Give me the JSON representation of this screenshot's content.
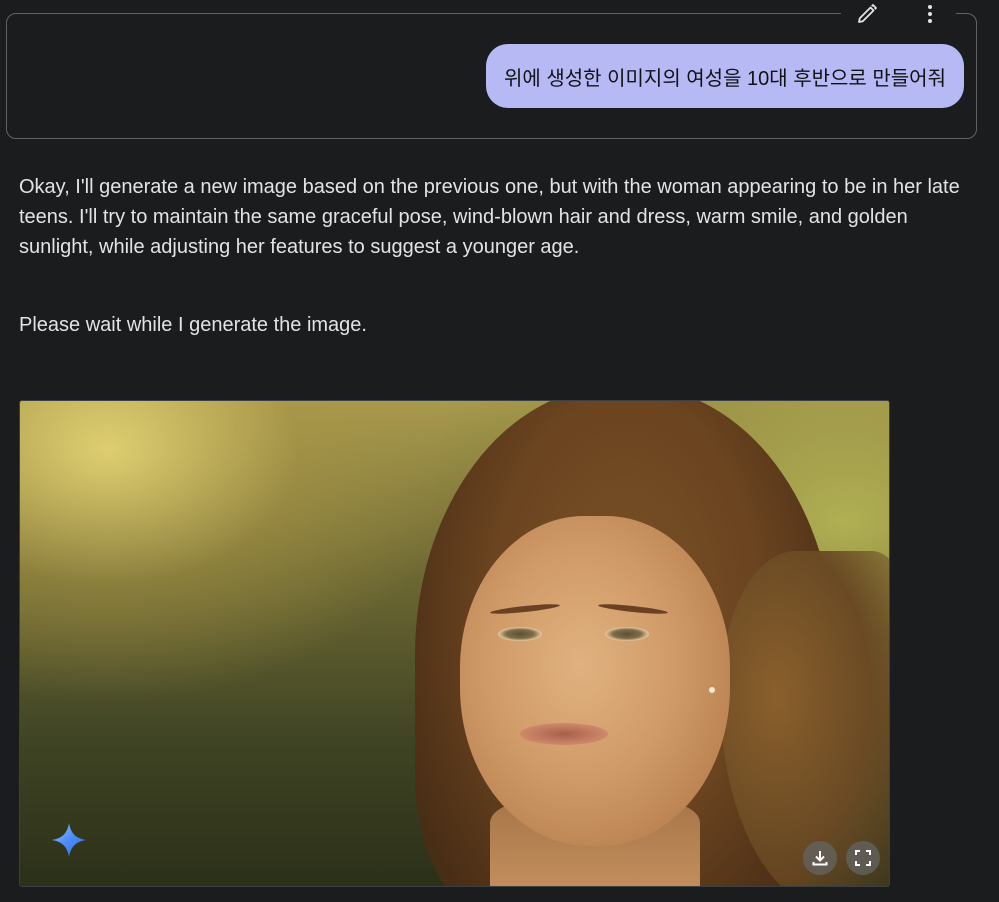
{
  "user_prompt": {
    "text": "위에 생성한 이미지의 여성을 10대 후반으로 만들어줘",
    "edit_icon": "pencil-icon",
    "more_icon": "more-vert-icon",
    "bubble_color": "#b7b9f5"
  },
  "response": {
    "paragraph_1": "Okay, I'll generate a new image based on the previous one, but with the woman appearing to be in her late teens. I'll try to maintain the same graceful pose, wind-blown hair and dress, warm smile, and golden sunlight, while adjusting her features to suggest a younger age.",
    "paragraph_2": "Please wait while I generate the image."
  },
  "generated_image": {
    "watermark_icon": "gemini-sparkle-icon",
    "download_icon": "download-icon",
    "fullscreen_icon": "fullscreen-icon"
  },
  "colors": {
    "background": "#1b1c1e",
    "text": "#e3e3e3",
    "sparkle_blue": "#4a8cf7"
  }
}
